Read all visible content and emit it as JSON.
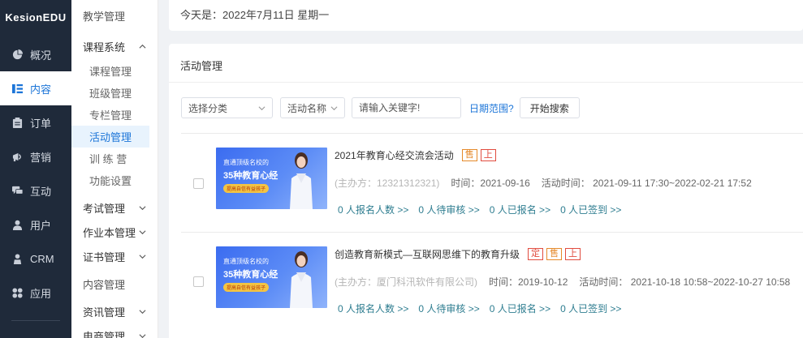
{
  "brand": "KesionEDU",
  "nav": {
    "items": [
      {
        "label": "概况"
      },
      {
        "label": "内容"
      },
      {
        "label": "订单"
      },
      {
        "label": "营销"
      },
      {
        "label": "互动"
      },
      {
        "label": "用户"
      },
      {
        "label": "CRM"
      },
      {
        "label": "应用"
      }
    ]
  },
  "subnav": {
    "teaching": "教学管理",
    "course_system": "课程系统",
    "course_items": [
      "课程管理",
      "班级管理",
      "专栏管理",
      "活动管理",
      "训 练 营",
      "功能设置"
    ],
    "exam": "考试管理",
    "homework": "作业本管理",
    "certificate": "证书管理",
    "content_mgmt": "内容管理",
    "news": "资讯管理",
    "ecommerce": "电商管理"
  },
  "main": {
    "date_text": "今天是：2022年7月11日 星期一",
    "card_title": "活动管理",
    "filters": {
      "category": "选择分类",
      "field": "活动名称",
      "keyword_placeholder": "请输入关键字!",
      "date_range": "日期范围?",
      "search_button": "开始搜索"
    },
    "rows": [
      {
        "thumb_line1": "直通顶级名校的",
        "thumb_line2": "35种教育心经",
        "thumb_line3": "提高自信有益孩子",
        "title": "2021年教育心经交流会活动",
        "tags": [
          "售",
          "上"
        ],
        "organizer": "(主办方：12321312321)",
        "time": "时间：2021-09-16",
        "activity_time": "活动时间：  2021-09-11 17:30~2022-02-21 17:52",
        "stats": [
          "0 人报名人数 >>",
          "0 人待审核 >>",
          "0 人已报名 >>",
          "0 人已签到 >>"
        ]
      },
      {
        "thumb_line1": "直通顶级名校的",
        "thumb_line2": "35种教育心经",
        "thumb_line3": "提高自信有益孩子",
        "title": "创造教育新模式—互联网思维下的教育升级",
        "tags": [
          "定",
          "售",
          "上"
        ],
        "organizer": "(主办方：厦门科汛软件有限公司)",
        "time": "时间：2019-10-12",
        "activity_time": "活动时间：  2021-10-18 10:58~2022-10-27 10:58",
        "stats": [
          "0 人报名人数 >>",
          "0 人待审核 >>",
          "0 人已报名 >>",
          "0 人已签到 >>"
        ]
      }
    ]
  }
}
